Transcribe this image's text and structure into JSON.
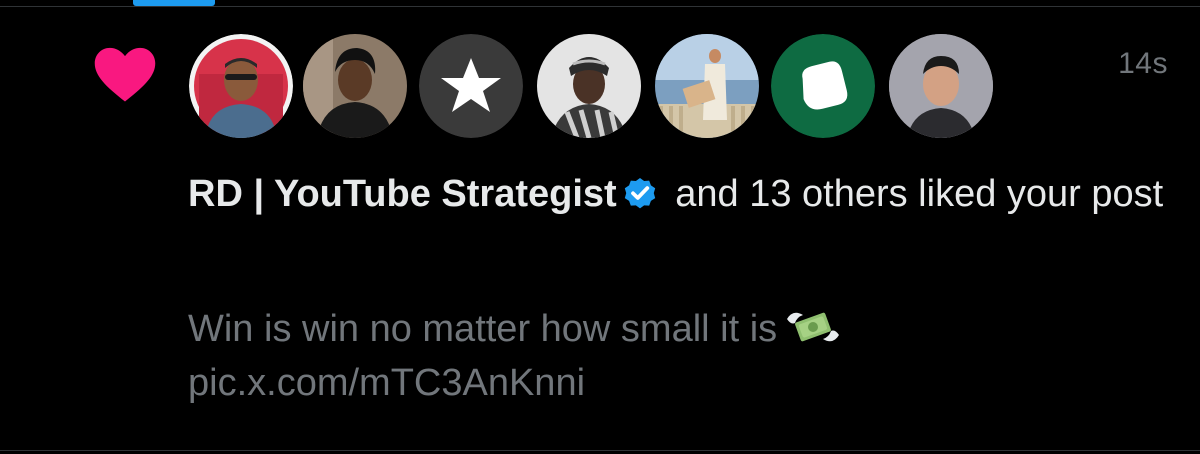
{
  "notification": {
    "timestamp": "14s",
    "actor_name": "RD | YouTube Strategist",
    "liked_suffix": " and 13 others liked your post",
    "post_text": "Win is win no matter how small it is",
    "post_link": "pic.x.com/mTC3AnKnni"
  },
  "avatars": [
    {
      "name": "avatar-1",
      "icon": "user-avatar"
    },
    {
      "name": "avatar-2",
      "icon": "user-avatar"
    },
    {
      "name": "avatar-3",
      "icon": "star-logo-avatar"
    },
    {
      "name": "avatar-4",
      "icon": "user-avatar"
    },
    {
      "name": "avatar-5",
      "icon": "user-avatar"
    },
    {
      "name": "avatar-6",
      "icon": "white-shape-logo-avatar"
    },
    {
      "name": "avatar-7",
      "icon": "user-avatar"
    }
  ],
  "colors": {
    "background": "#000000",
    "heart": "#f91880",
    "verified": "#1d9bf0",
    "primary_text": "#e7e9ea",
    "secondary_text": "#71767b",
    "divider": "#2f3336",
    "tab_indicator": "#1d9bf0"
  },
  "icons": {
    "like": "heart-icon",
    "verified": "verified-badge-icon",
    "emoji": "money-with-wings-icon"
  }
}
